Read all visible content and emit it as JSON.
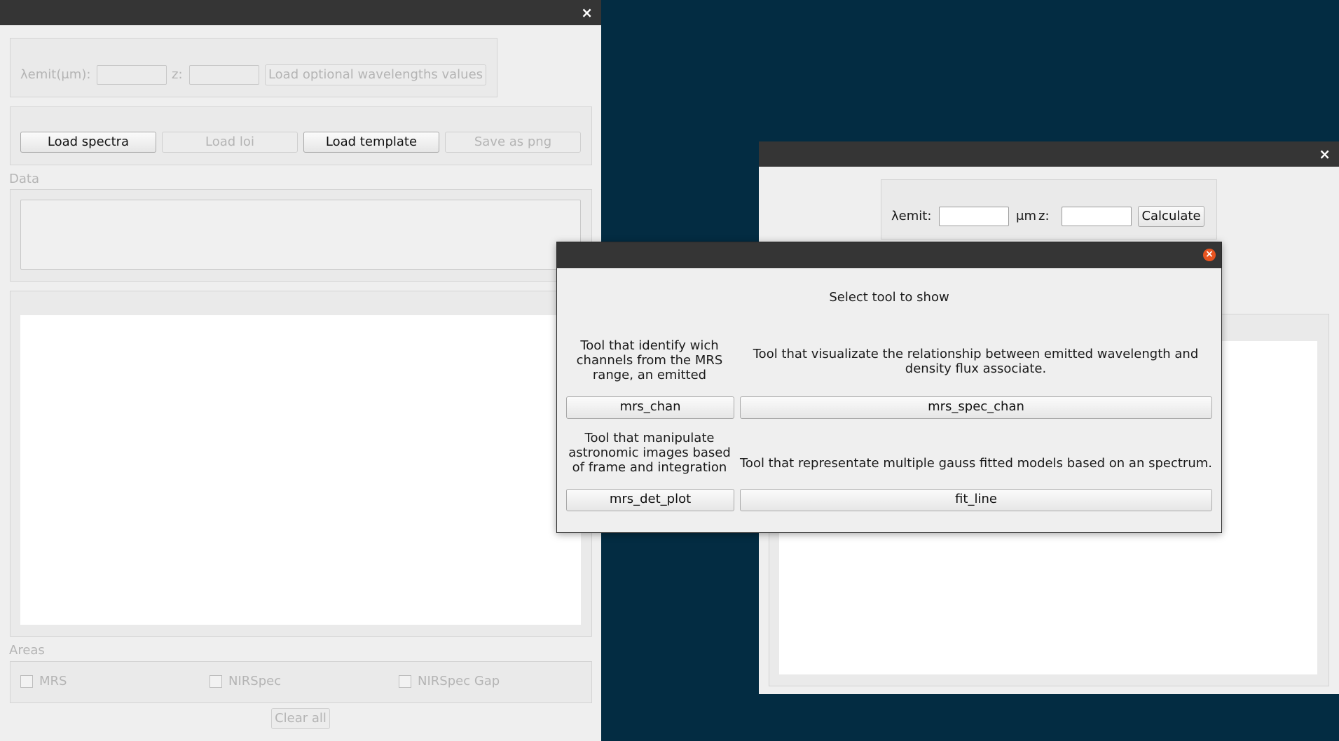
{
  "main_window": {
    "close_symbol": "×",
    "wave_label": "λemit(μm):",
    "z_label": "z:",
    "load_optional_label": "Load optional wavelengths values",
    "buttons": {
      "load_spectra": "Load spectra",
      "load_loi": "Load loi",
      "load_template": "Load template",
      "save_png": "Save as png"
    },
    "data_label": "Data",
    "areas_label": "Areas",
    "areas": [
      "MRS",
      "NIRSpec",
      "NIRSpec Gap"
    ],
    "clear_all": "Clear all"
  },
  "calc_window": {
    "close_symbol": "×",
    "wave_label": "λemit:",
    "unit": "μm",
    "z_label": "z:",
    "calculate": "Calculate"
  },
  "dialog": {
    "heading": "Select tool to show",
    "tools": [
      {
        "desc": "Tool that identify wich channels from the MRS range, an emitted",
        "button": "mrs_chan"
      },
      {
        "desc": "Tool that visualizate the relationship between emitted wavelength and density flux associate.",
        "button": "mrs_spec_chan"
      },
      {
        "desc": "Tool that manipulate astronomic images based of frame and integration",
        "button": "mrs_det_plot"
      },
      {
        "desc": "Tool that representate multiple gauss fitted models based on an spectrum.",
        "button": "fit_line"
      }
    ],
    "close_color": "#e95420"
  },
  "colors": {
    "desktop": "#032c42",
    "titlebar": "#353535",
    "window": "#efefef"
  }
}
